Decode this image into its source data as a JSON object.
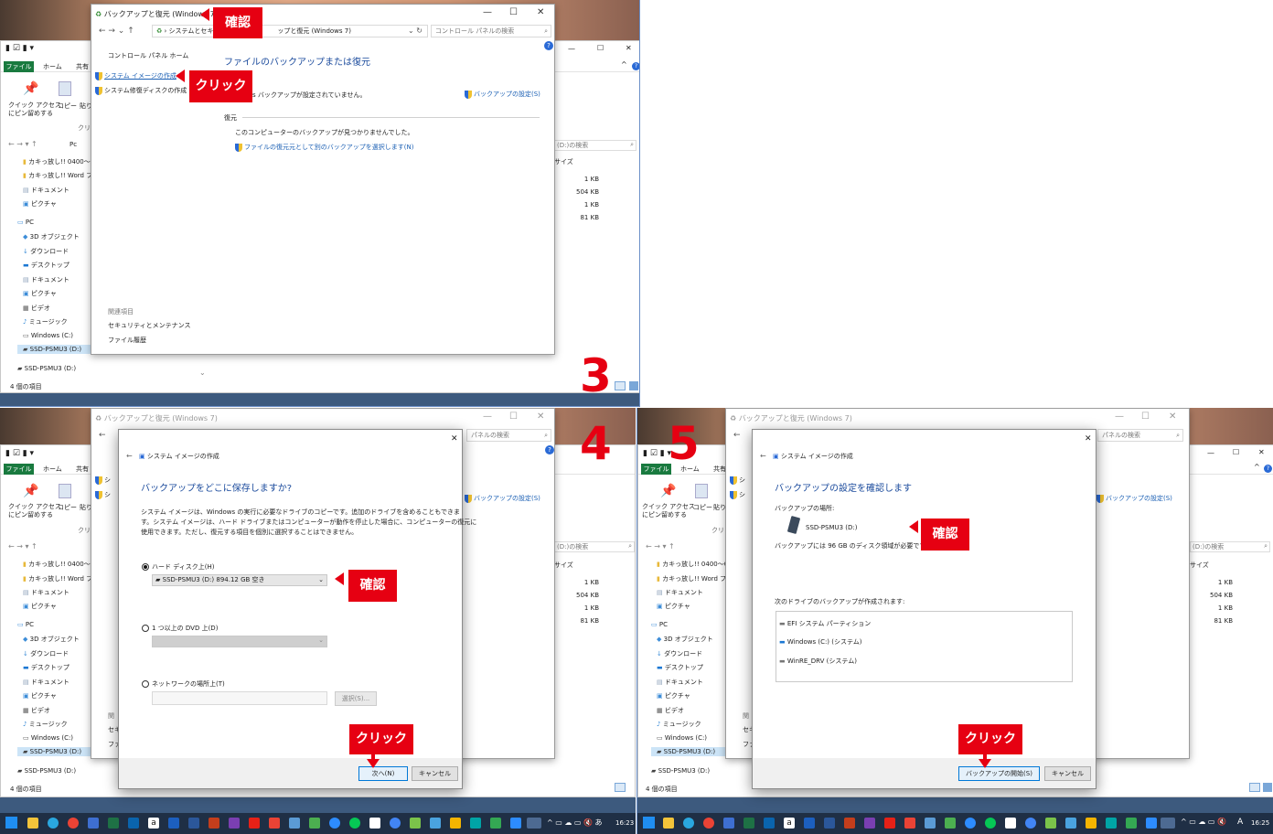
{
  "cp_window": {
    "title": "バックアップと復元 (Windows 7)",
    "address": "システムとセキュリティ › バックアップと復元 (Windows 7)",
    "address_short": "› システムとセキ",
    "address_tail": "ップと復元 (Windows 7)",
    "search_placeholder": "コントロール パネルの検索",
    "search_short": "パネルの検索",
    "home": "コントロール パネル ホーム",
    "link_create_image": "システム イメージの作成",
    "link_repair_disc": "システム修復ディスクの作成",
    "heading": "ファイルのバックアップまたは復元",
    "backup_label": "バックアップ",
    "backup_status": "Windows バックアップが設定されていません。",
    "backup_status_partial": "ows バックアップが設定されていません。",
    "setup_link": "バックアップの設定(S)",
    "restore_label": "復元",
    "restore_status": "このコンピューターのバックアップが見つかりませんでした。",
    "restore_link": "ファイルの復元元として別のバックアップを選択します(N)",
    "related": "関連項目",
    "related_security": "セキュリティとメンテナンス",
    "related_history": "ファイル履歴",
    "related_short_1": "関",
    "related_short_2": "セキ",
    "related_short_3": "ファ",
    "left_short_1": "シ",
    "left_short_2": "シ"
  },
  "explorer": {
    "tab_file": "ファイル",
    "tab_home": "ホーム",
    "tab_share": "共有",
    "pin_label": "クイック アクセス\nにピン留めする",
    "pin_l1": "クイック アクセス",
    "pin_l2": "にピン留めする",
    "copy": "コピー",
    "paste": "貼り",
    "clip": "クリ",
    "path_short": "Pc",
    "search": "SSD-PSMU3 (D:)の検索",
    "search_short": "(D:)の検索",
    "col_size": "サイズ",
    "nav": [
      "カキっ放し!! 0400～0",
      "カキっ放し!! Word フ",
      "ドキュメント",
      "ピクチャ",
      "PC",
      "3D オブジェクト",
      "ダウンロード",
      "デスクトップ",
      "ドキュメント",
      "ピクチャ",
      "ビデオ",
      "ミュージック",
      "Windows (C:)",
      "SSD-PSMU3 (D:)",
      "SSD-PSMU3 (D:)"
    ],
    "sizes": [
      "1 KB",
      "504 KB",
      "1 KB",
      "81 KB"
    ],
    "status": "4 個の項目"
  },
  "dialog4": {
    "title": "システム イメージの作成",
    "question": "バックアップをどこに保存しますか?",
    "desc1": "システム イメージは、Windows の実行に必要なドライブのコピーです。追加のドライブを含めることもできま",
    "desc2": "す。システム イメージは、ハード ドライブまたはコンピューターが動作を停止した場合に、コンピューターの復元に",
    "desc3": "使用できます。ただし、復元する項目を個別に選択することはできません。",
    "opt_hdd": "ハード ディスク上(H)",
    "hdd_value": "SSD-PSMU3 (D:)  894.12 GB 空き",
    "opt_dvd": "1 つ以上の DVD 上(D)",
    "opt_net": "ネットワークの場所上(T)",
    "browse": "選択(S)...",
    "next": "次へ(N)",
    "cancel": "キャンセル"
  },
  "dialog5": {
    "title": "システム イメージの作成",
    "heading": "バックアップの設定を確認します",
    "loc_label": "バックアップの場所:",
    "loc_value": "SSD-PSMU3 (D:)",
    "space": "バックアップには 96 GB のディスク領域が必要です。",
    "list_label": "次のドライブのバックアップが作成されます:",
    "drives": [
      "EFI システム パーティション",
      "Windows (C:) (システム)",
      "WinRE_DRV (システム)"
    ],
    "start": "バックアップの開始(S)",
    "cancel": "キャンセル"
  },
  "annotations": {
    "confirm": "確認",
    "click": "クリック",
    "step3": "3",
    "step4": "4",
    "step5": "5"
  },
  "taskbar": {
    "time_left": "16:23",
    "time_right": "16:25",
    "ime": "A"
  },
  "colors": {
    "accent_red": "#e60012",
    "link_blue": "#1a5fb4",
    "ribbon_green": "#197a3f",
    "taskbar": "#1f2f45"
  }
}
